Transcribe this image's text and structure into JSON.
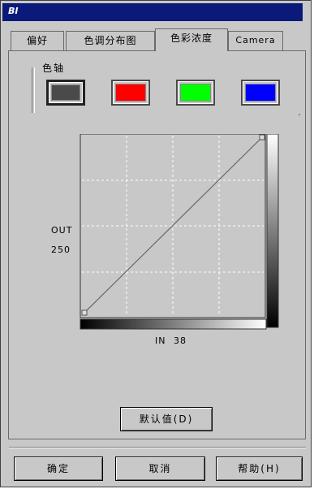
{
  "window": {
    "title": "BI"
  },
  "tabs": [
    {
      "label": "偏好",
      "active": false
    },
    {
      "label": "色调分布图",
      "active": false
    },
    {
      "label": "色彩浓度",
      "active": true
    },
    {
      "label": "Camera",
      "active": false
    }
  ],
  "color_group": {
    "label": "色轴",
    "swatches": [
      {
        "name": "gray",
        "color": "#4a4a4a",
        "selected": true
      },
      {
        "name": "red",
        "color": "#ff0000",
        "selected": false
      },
      {
        "name": "green",
        "color": "#00ff00",
        "selected": false
      },
      {
        "name": "blue",
        "color": "#0000ff",
        "selected": false
      }
    ]
  },
  "curve": {
    "out_label": "OUT",
    "out_value": "250",
    "in_label": "IN",
    "in_value": "38"
  },
  "buttons": {
    "default": "默认值(D)",
    "ok": "确定",
    "cancel": "取消",
    "help": "帮助(H)"
  }
}
